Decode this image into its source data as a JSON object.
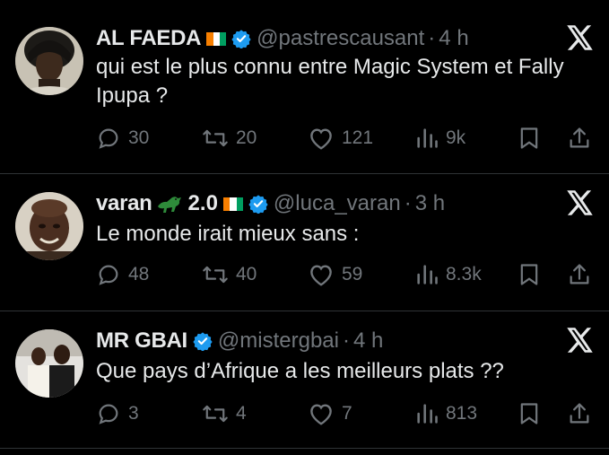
{
  "tweets": [
    {
      "name": "AL FAEDA",
      "handle": "@pastrescausant",
      "separator": "·",
      "time": "4 h",
      "text": "qui est le plus connu entre Magic System et Fally Ipupa ?",
      "replies": "30",
      "retweets": "20",
      "likes": "121",
      "views": "9k"
    },
    {
      "name": "varan",
      "version": "2.0",
      "handle": "@luca_varan",
      "separator": "·",
      "time": "3 h",
      "text": "Le monde irait mieux sans :",
      "replies": "48",
      "retweets": "40",
      "likes": "59",
      "views": "8.3k"
    },
    {
      "name": "MR GBAI",
      "handle": "@mistergbai",
      "separator": "·",
      "time": "4 h",
      "text": "Que pays d’Afrique a les meilleurs plats ??",
      "replies": "3",
      "retweets": "4",
      "likes": "7",
      "views": "813"
    }
  ],
  "colors": {
    "background": "#000000",
    "text": "#e7e9ea",
    "muted": "#71767b",
    "verified": "#1d9bf0",
    "flag_orange": "#f77f00",
    "flag_white": "#ffffff",
    "flag_green": "#009e60",
    "croc": "#2e8b3a"
  },
  "icons": [
    "x-logo-icon",
    "verified-badge-icon",
    "reply-icon",
    "retweet-icon",
    "like-icon",
    "views-icon",
    "bookmark-icon",
    "share-icon",
    "ivory-coast-flag-icon",
    "crocodile-emoji-icon"
  ]
}
